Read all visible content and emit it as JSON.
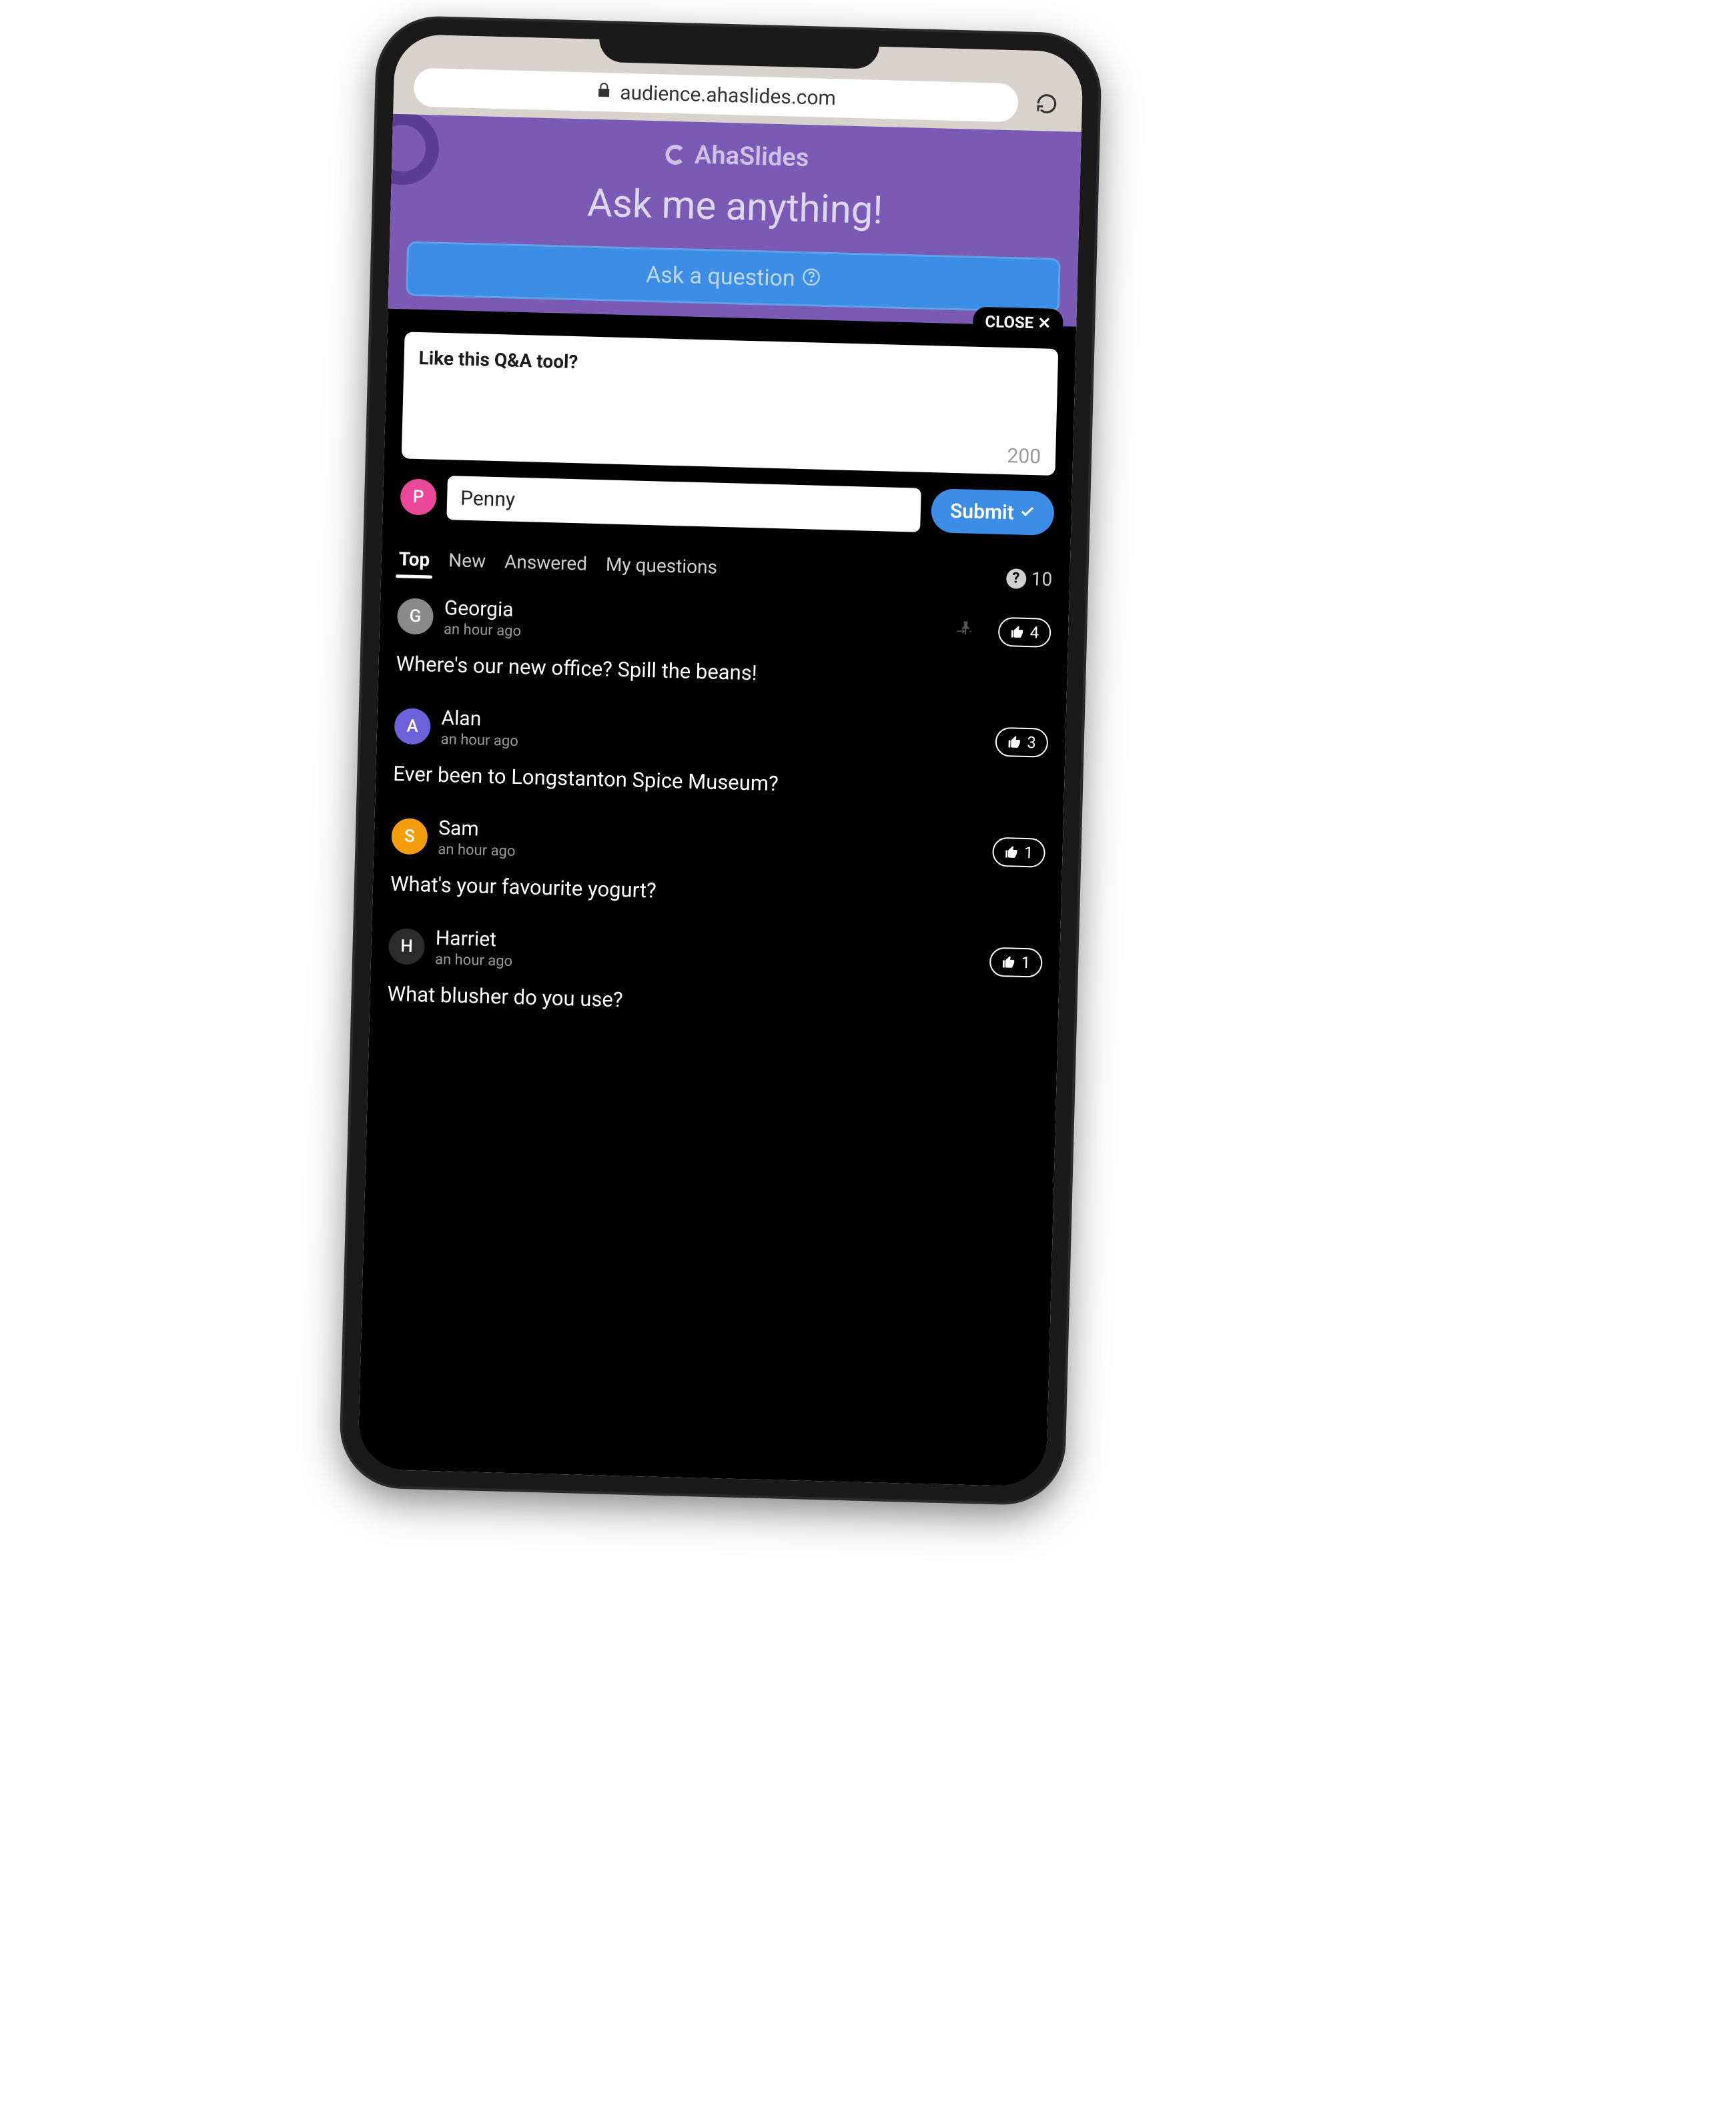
{
  "browser": {
    "url": "audience.ahaslides.com"
  },
  "brand": "AhaSlides",
  "heading": "Ask me anything!",
  "ask_bar": "Ask a question",
  "close_label": "CLOSE",
  "compose": {
    "text": "Like this Q&A tool?",
    "counter": "200",
    "user_initial": "P",
    "user_name": "Penny",
    "submit_label": "Submit"
  },
  "tabs": [
    "Top",
    "New",
    "Answered",
    "My questions"
  ],
  "active_tab": 0,
  "question_count": "10",
  "avatar_colors": {
    "P": "#ec4899",
    "G": "#8a8a8a",
    "A": "#6b62d9",
    "S": "#f59e0b",
    "H": "#2b2b2b"
  },
  "questions": [
    {
      "initial": "G",
      "name": "Georgia",
      "time": "an hour ago",
      "likes": "4",
      "pinned": true,
      "text": "Where's our new office? Spill the beans!"
    },
    {
      "initial": "A",
      "name": "Alan",
      "time": "an hour ago",
      "likes": "3",
      "pinned": false,
      "text": "Ever been to Longstanton Spice Museum?"
    },
    {
      "initial": "S",
      "name": "Sam",
      "time": "an hour ago",
      "likes": "1",
      "pinned": false,
      "text": "What's your favourite yogurt?"
    },
    {
      "initial": "H",
      "name": "Harriet",
      "time": "an hour ago",
      "likes": "1",
      "pinned": false,
      "text": "What blusher do you use?"
    }
  ]
}
